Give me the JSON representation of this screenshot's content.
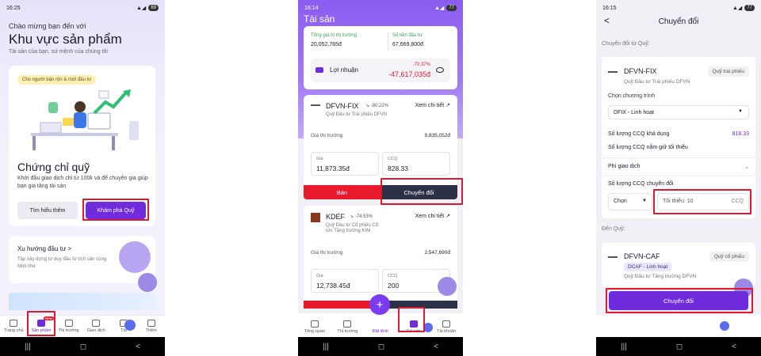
{
  "screen1": {
    "status": {
      "time": "16:25",
      "battery": "69"
    },
    "greeting": "Chào mừng bạn đến với",
    "title": "Khu vực sản phẩm",
    "subtitle": "Tài sản của bạn, sứ mệnh của chúng tôi",
    "card": {
      "tag": "Cho người bận rộn & mới đầu tư",
      "heading": "Chứng chỉ quỹ",
      "description": "Khởi đầu giao dịch chỉ từ 100k và để chuyên gia giúp bạn gia tăng tài sản",
      "learn_more": "Tìm hiểu thêm",
      "explore": "Khám phá Quỹ"
    },
    "trend": {
      "title": "Xu hướng đầu tư  >",
      "description": "Tập xây dựng tư duy đầu tư tích sản cùng Moli nhé"
    },
    "tabs": [
      {
        "label": "Trang chủ"
      },
      {
        "label": "Sản phẩm",
        "badge": "New"
      },
      {
        "label": "Thị trường"
      },
      {
        "label": "Giao dịch"
      },
      {
        "label": "Tài"
      },
      {
        "label": "Thêm"
      }
    ]
  },
  "screen2": {
    "status": {
      "time": "16:14",
      "battery": "77"
    },
    "title": "Tài sản",
    "summary": {
      "market_value_label": "Tổng giá trị thị trường",
      "market_value": "20,052,765đ",
      "invested_label": "Số tiền đầu tư",
      "invested": "67,669,800đ",
      "profit_label": "Lợi nhuận",
      "profit_pct": "-70.37%",
      "profit_amount": "-47,617,035đ"
    },
    "funds": [
      {
        "code": "DFVN-FIX",
        "change": "-80.22%",
        "detail_label": "Xem chi tiết ↗",
        "description": "Quỹ Đầu tư Trái phiếu DFVN",
        "market_label": "Giá thị trường",
        "market_value": "9,835,052đ",
        "price_label": "Giá",
        "price": "11,873.35đ",
        "units_label": "CCQ",
        "units": "828.33",
        "sell_label": "Bán",
        "convert_label": "Chuyển đổi"
      },
      {
        "code": "KDEF",
        "change": "-74.53%",
        "detail_label": "Xem chi tiết ↗",
        "description": "Quỹ Đầu tư Cổ phiếu Cổ tức Tăng trưởng KIM",
        "market_label": "Giá thị trường",
        "market_value": "2,547,690đ",
        "price_label": "Giá",
        "price": "12,738.45đ",
        "units_label": "CCQ",
        "units": "200",
        "logo_text": "KIM"
      }
    ],
    "tabs": [
      {
        "label": "Tổng quan"
      },
      {
        "label": "Thị trường"
      },
      {
        "label": "Đặt lệnh"
      },
      {
        "label": "Tài sản"
      },
      {
        "label": "Tài khoản"
      }
    ],
    "fab": "+"
  },
  "screen3": {
    "status": {
      "time": "16:15",
      "battery": "77"
    },
    "back": "<",
    "title": "Chuyển đổi",
    "from_label": "Chuyển đổi từ Quỹ:",
    "from": {
      "code": "DFVN-FIX",
      "chip": "Quỹ trái phiếu",
      "description": "Quỹ Đầu tư Trái phiếu DFVN",
      "program_label": "Chọn chương trình",
      "program_value": "DFIX - Linh hoạt",
      "available_label": "Số lượng CCQ khả dụng",
      "available_value": "818.33",
      "min_hold_label": "Số lượng CCQ nắm giữ tối thiểu",
      "fee_label": "Phí giao dịch",
      "convert_qty_label": "Số lượng CCQ chuyển đổi",
      "choose": "Chọn",
      "min_placeholder": "Tối thiểu: 10",
      "unit": "CCQ"
    },
    "to_label": "Đến Quỹ:",
    "to": {
      "code": "DFVN-CAF",
      "chip": "Quỹ cổ phiếu",
      "program": "DCAF - Linh hoạt",
      "description": "Quỹ Đầu tư Tăng trưởng DFVN"
    },
    "button": "Chuyển đổi"
  },
  "colors": {
    "accent": "#6f2bdc",
    "sell": "#e8192c",
    "convert": "#2d3148",
    "highlight": "#e0182d"
  }
}
